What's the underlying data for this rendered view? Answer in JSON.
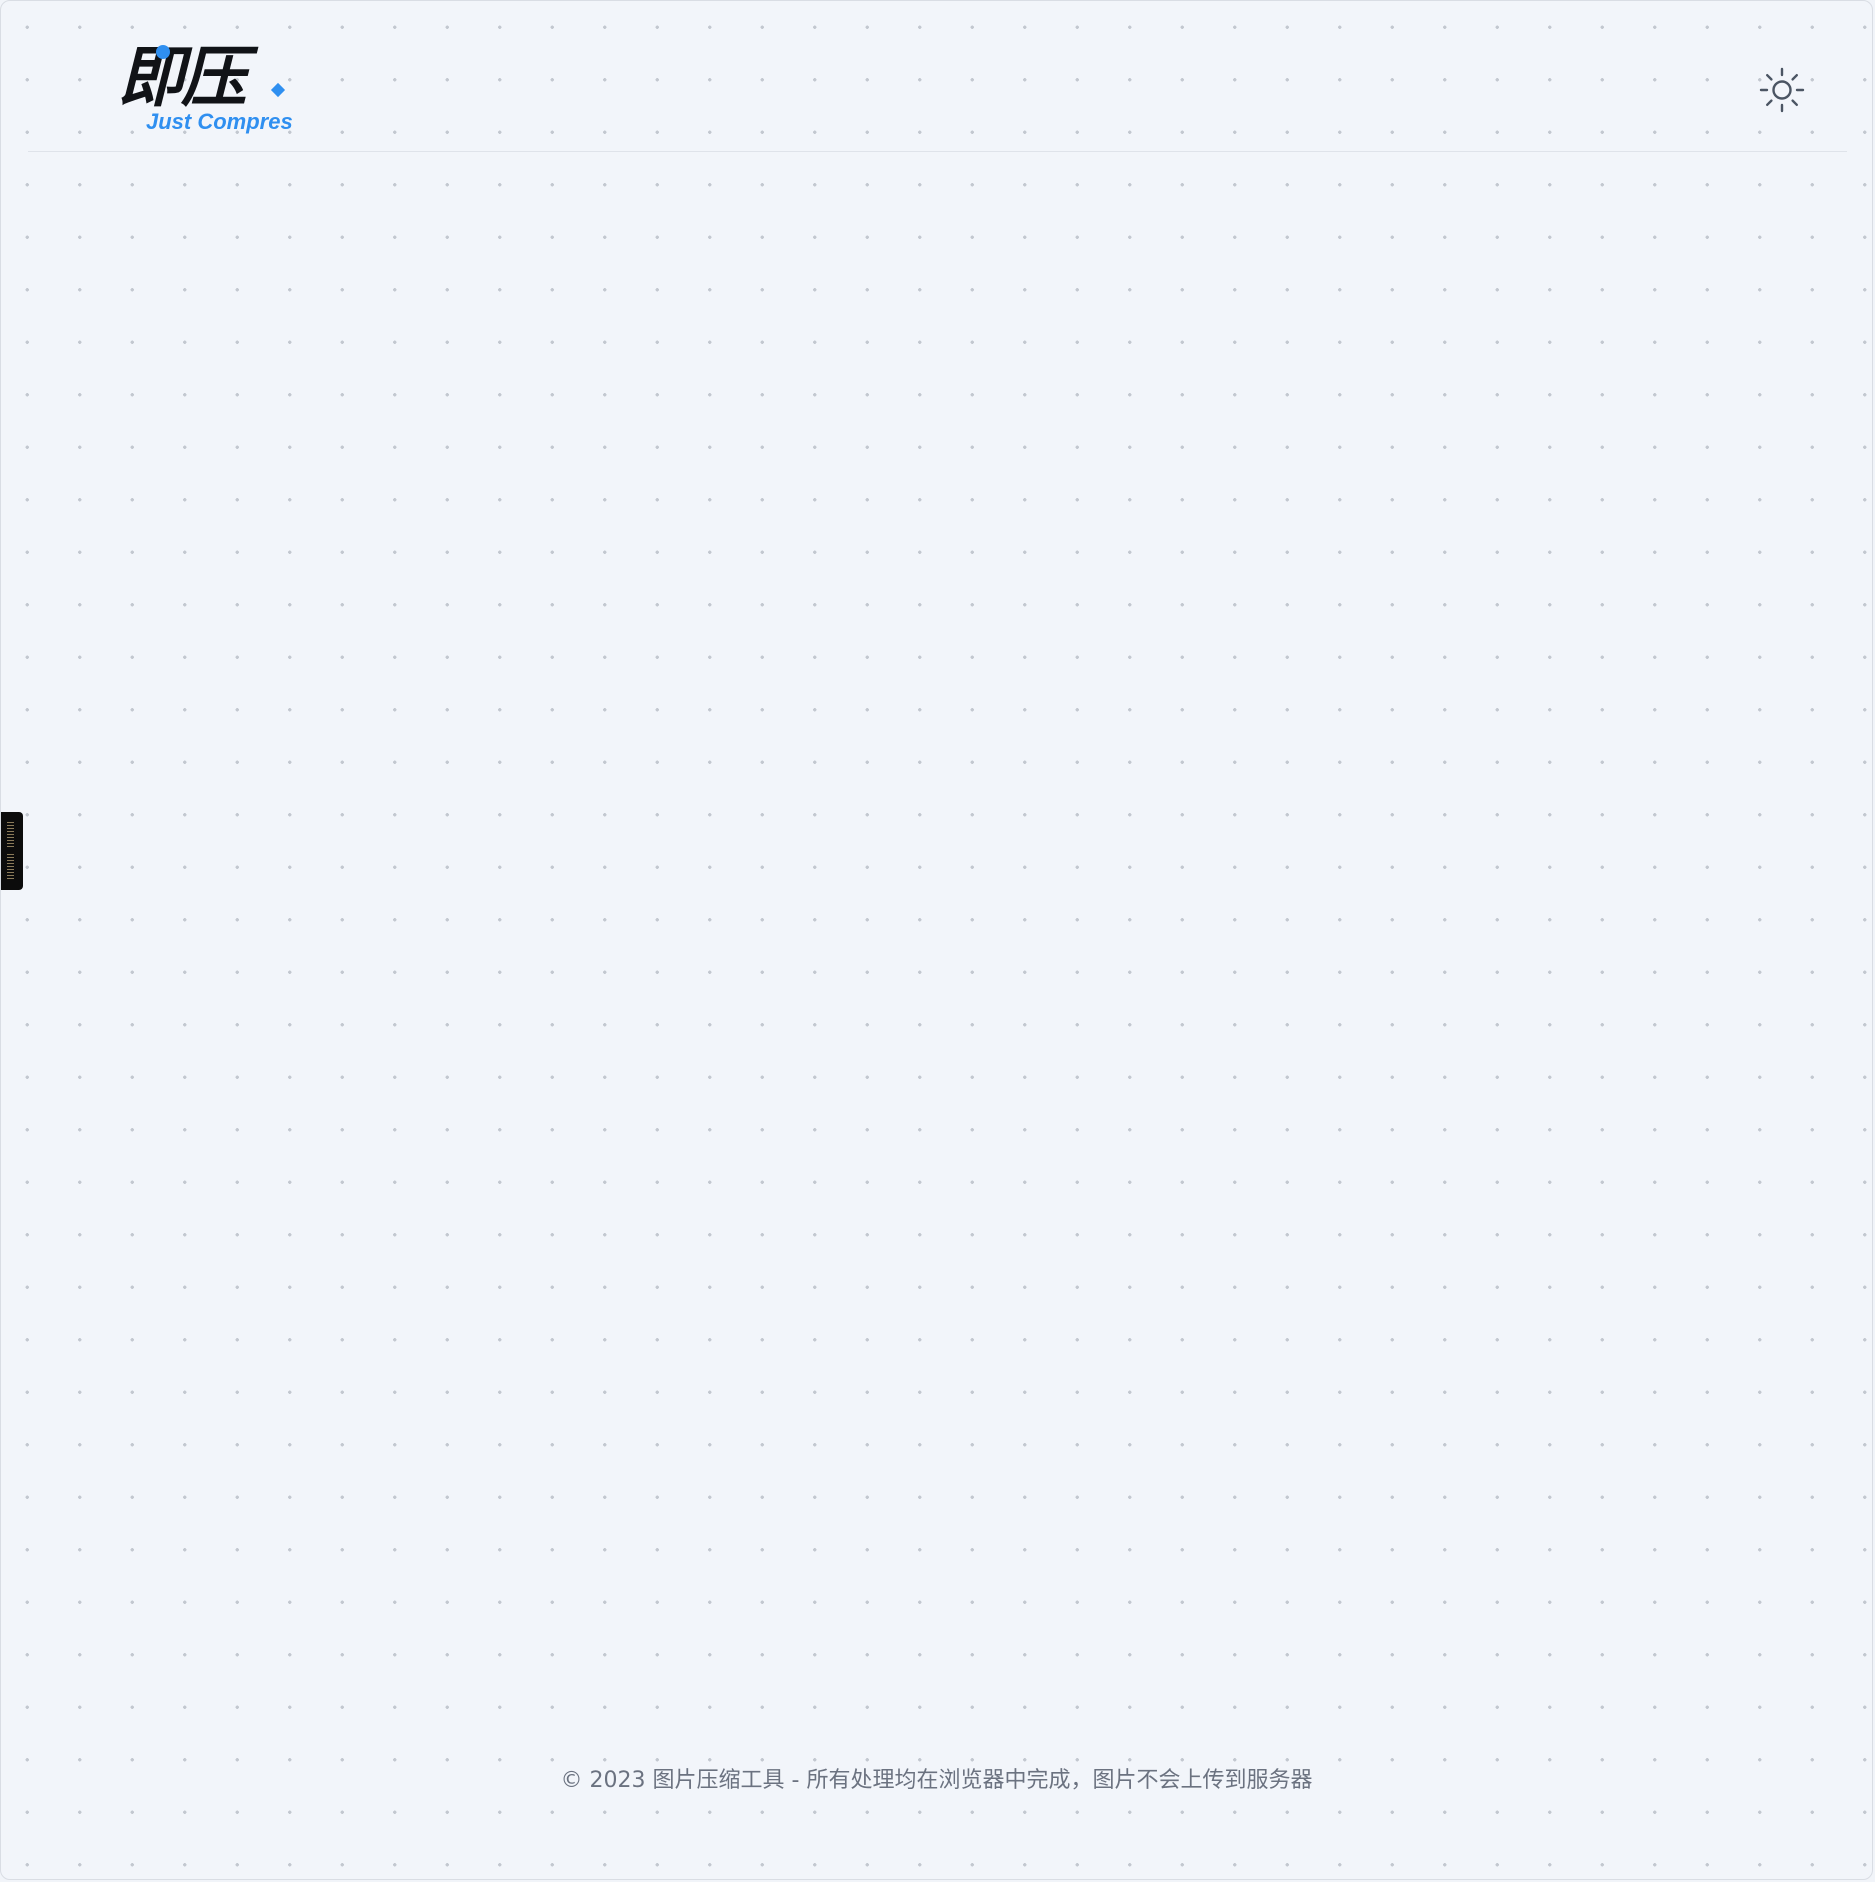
{
  "app": {
    "logo_cn": "即压",
    "logo_en": "Just Compres",
    "theme_toggle_icon": "sun-icon"
  },
  "side_handle": {
    "icon": "drag-handle-icon"
  },
  "footer": {
    "copyright": "© 2023 图片压缩工具 - 所有处理均在浏览器中完成，图片不会上传到服务器"
  },
  "colors": {
    "background": "#f2f5fa",
    "dot": "#c3c8d0",
    "brand_blue": "#2f8ff0",
    "logo_black": "#111317",
    "footer_text": "#6b7280"
  }
}
